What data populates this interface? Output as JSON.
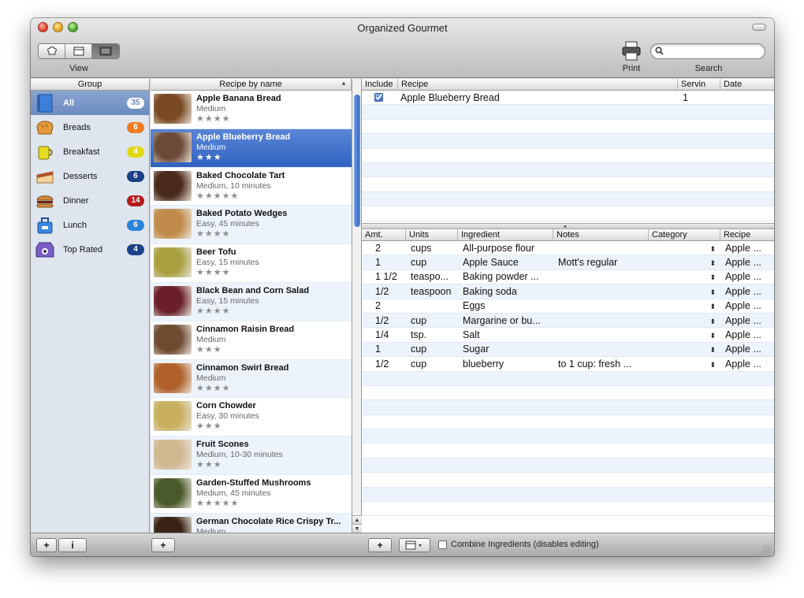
{
  "window": {
    "title": "Organized Gourmet"
  },
  "toolbar": {
    "view_label": "View",
    "print_label": "Print",
    "search_label": "Search",
    "search_placeholder": ""
  },
  "groups": {
    "header": "Group",
    "items": [
      {
        "label": "All",
        "count": "35",
        "badge_color": "#ffffff",
        "badge_text_color": "#6c8ac0",
        "icon": "blue-book-icon",
        "selected": true
      },
      {
        "label": "Breads",
        "count": "6",
        "badge_color": "#f07b22",
        "icon": "bread-icon"
      },
      {
        "label": "Breakfast",
        "count": "4",
        "badge_color": "#e2d817",
        "icon": "cup-icon"
      },
      {
        "label": "Desserts",
        "count": "6",
        "badge_color": "#1b3f87",
        "icon": "cake-icon"
      },
      {
        "label": "Dinner",
        "count": "14",
        "badge_color": "#b31b1b",
        "icon": "burger-icon"
      },
      {
        "label": "Lunch",
        "count": "6",
        "badge_color": "#2a83d9",
        "icon": "lunchbox-icon"
      },
      {
        "label": "Top Rated",
        "count": "4",
        "badge_color": "#1b3f87",
        "icon": "top-rated-icon"
      }
    ]
  },
  "recipes": {
    "header": "Recipe by name",
    "items": [
      {
        "name": "Apple Banana Bread",
        "meta": "Medium",
        "stars": "★★★★",
        "thumb": "#7a4a24"
      },
      {
        "name": "Apple Blueberry Bread",
        "meta": "Medium",
        "stars": "★★★",
        "thumb": "#6b4a38",
        "selected": true
      },
      {
        "name": "Baked Chocolate Tart",
        "meta": "Medium, 10 minutes",
        "stars": "★★★★★",
        "thumb": "#4a2a1a"
      },
      {
        "name": "Baked Potato Wedges",
        "meta": "Easy, 45 minutes",
        "stars": "★★★★",
        "thumb": "#c08a4a"
      },
      {
        "name": "Beer Tofu",
        "meta": "Easy, 15 minutes",
        "stars": "★★★★",
        "thumb": "#a8a040"
      },
      {
        "name": "Black Bean and Corn Salad",
        "meta": "Easy, 15 minutes",
        "stars": "★★★★",
        "thumb": "#6a1f2a"
      },
      {
        "name": "Cinnamon Raisin Bread",
        "meta": "Medium",
        "stars": "★★★",
        "thumb": "#6d4a30"
      },
      {
        "name": "Cinnamon Swirl Bread",
        "meta": "Medium",
        "stars": "★★★★",
        "thumb": "#b0602a"
      },
      {
        "name": "Corn Chowder",
        "meta": "Easy, 30 minutes",
        "stars": "★★★",
        "thumb": "#c8b060"
      },
      {
        "name": "Fruit Scones",
        "meta": "Medium, 10-30 minutes",
        "stars": "★★★",
        "thumb": "#d0b890"
      },
      {
        "name": "Garden-Stuffed Mushrooms",
        "meta": "Medium, 45 minutes",
        "stars": "★★★★★",
        "thumb": "#4a5a2a"
      },
      {
        "name": "German Chocolate Rice Crispy Tr...",
        "meta": "Medium",
        "stars": "",
        "thumb": "#3a2418"
      }
    ]
  },
  "plan": {
    "headers": {
      "include": "Include",
      "recipe": "Recipe",
      "servings": "Servin",
      "date": "Date"
    },
    "rows": [
      {
        "include": true,
        "recipe": "Apple Blueberry Bread",
        "servings": "1",
        "date": ""
      }
    ]
  },
  "ingredients": {
    "headers": {
      "amt": "Amt.",
      "units": "Units",
      "ingredient": "Ingredient",
      "notes": "Notes",
      "category": "Category",
      "recipe": "Recipe"
    },
    "rows": [
      {
        "amt": "2",
        "units": "cups",
        "ingredient": "All-purpose flour",
        "notes": "",
        "recipe": "Apple ..."
      },
      {
        "amt": "1",
        "units": "cup",
        "ingredient": "Apple Sauce",
        "notes": "Mott's regular",
        "recipe": "Apple ..."
      },
      {
        "amt": "1 1/2",
        "units": "teaspo...",
        "ingredient": "Baking powder ...",
        "notes": "",
        "recipe": "Apple ..."
      },
      {
        "amt": "1/2",
        "units": "teaspoon",
        "ingredient": "Baking soda",
        "notes": "",
        "recipe": "Apple ..."
      },
      {
        "amt": "2",
        "units": "",
        "ingredient": "Eggs",
        "notes": "",
        "recipe": "Apple ..."
      },
      {
        "amt": "1/2",
        "units": "cup",
        "ingredient": "Margarine or bu...",
        "notes": "",
        "recipe": "Apple ..."
      },
      {
        "amt": "1/4",
        "units": "tsp.",
        "ingredient": "Salt",
        "notes": "",
        "recipe": "Apple ..."
      },
      {
        "amt": "1",
        "units": "cup",
        "ingredient": "Sugar",
        "notes": "",
        "recipe": "Apple ..."
      },
      {
        "amt": "1/2",
        "units": "cup",
        "ingredient": "blueberry",
        "notes": "to 1 cup: fresh ...",
        "recipe": "Apple ..."
      }
    ]
  },
  "bottom": {
    "add": "+",
    "info": "i",
    "combine_label": "Combine Ingredients (disables editing)"
  }
}
